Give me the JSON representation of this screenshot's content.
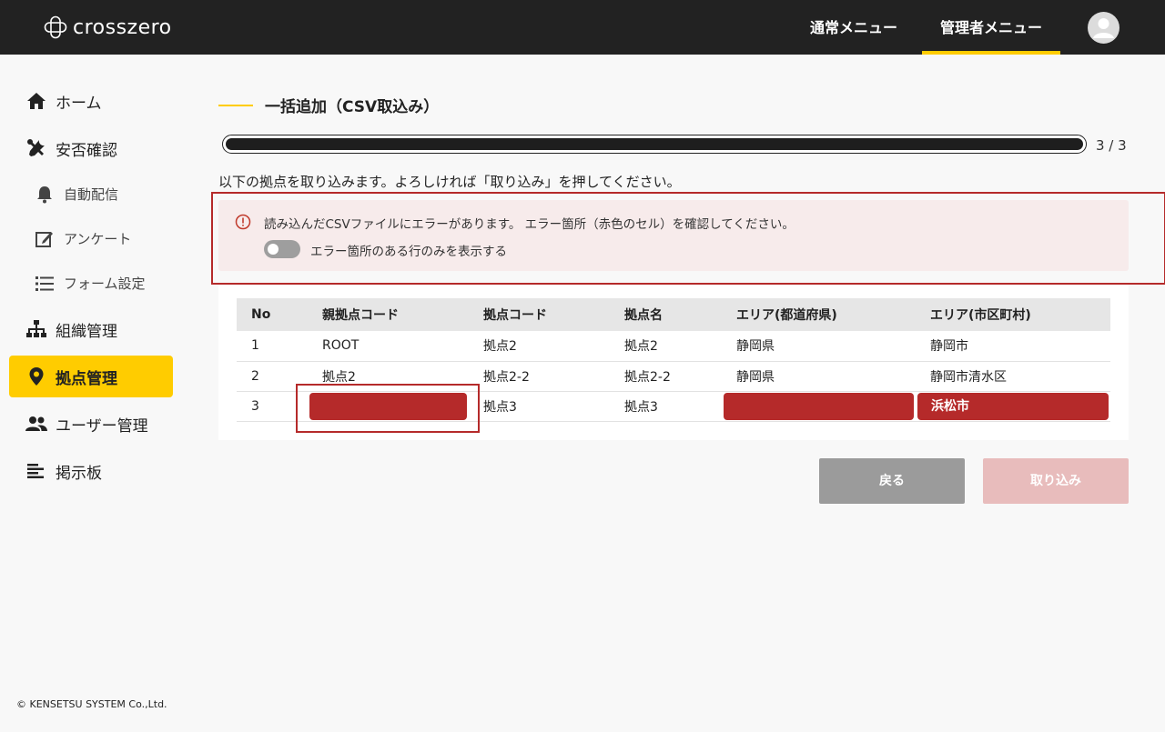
{
  "header": {
    "logo_text": "crosszero",
    "nav_normal": "通常メニュー",
    "nav_admin": "管理者メニュー"
  },
  "sidebar": {
    "items": [
      {
        "label": "ホーム",
        "icon": "home-icon"
      },
      {
        "label": "安否確認",
        "icon": "tools-icon"
      },
      {
        "label": "自動配信",
        "icon": "bell-icon"
      },
      {
        "label": "アンケート",
        "icon": "edit-icon"
      },
      {
        "label": "フォーム設定",
        "icon": "list-icon"
      },
      {
        "label": "組織管理",
        "icon": "org-chart-icon"
      },
      {
        "label": "拠点管理",
        "icon": "map-pin-icon",
        "active": true
      },
      {
        "label": "ユーザー管理",
        "icon": "users-icon"
      },
      {
        "label": "掲示板",
        "icon": "board-icon"
      }
    ]
  },
  "main": {
    "title": "一括追加（CSV取込み）",
    "progress": {
      "value": 1.0,
      "label": "3 / 3"
    },
    "instruction": "以下の拠点を取り込みます。よろしければ「取り込み」を押してください。",
    "error": {
      "message": "読み込んだCSVファイルにエラーがあります。 エラー箇所（赤色のセル）を確認してください。",
      "toggle_label": "エラー箇所のある行のみを表示する",
      "toggle_on": false
    },
    "table": {
      "headers": [
        "No",
        "親拠点コード",
        "拠点コード",
        "拠点名",
        "エリア(都道府県)",
        "エリア(市区町村)"
      ],
      "rows": [
        [
          "1",
          "ROOT",
          "拠点2",
          "拠点2",
          "静岡県",
          "静岡市"
        ],
        [
          "2",
          "拠点2",
          "拠点2-2",
          "拠点2-2",
          "静岡県",
          "静岡市清水区"
        ],
        [
          "3",
          "",
          "拠点3",
          "拠点3",
          "",
          "浜松市"
        ]
      ]
    },
    "buttons": {
      "back": "戻る",
      "import": "取り込み"
    }
  },
  "footer": {
    "copyright": "© KENSETSU SYSTEM Co.,Ltd."
  },
  "colors": {
    "accent": "#ffcc00",
    "error": "#b52a2a",
    "topbar": "#222222"
  }
}
